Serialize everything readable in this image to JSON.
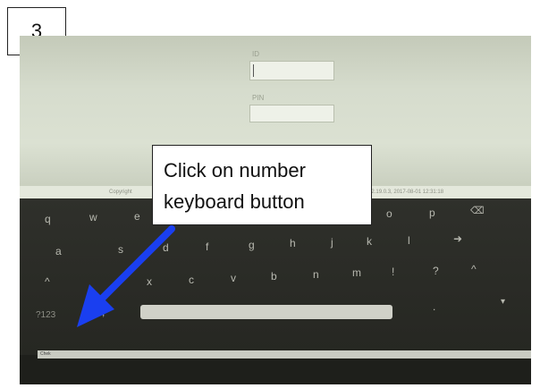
{
  "step": {
    "number": "3"
  },
  "login": {
    "id_label": "ID",
    "pin_label": "PIN"
  },
  "status": {
    "left_text": "Copyright",
    "right_text": "2.27.01, 2.19.0.3, 2017-08-01 12:31:18"
  },
  "keyboard": {
    "row1": [
      "q",
      "w",
      "e",
      "",
      "",
      "",
      "",
      "",
      "o",
      "p"
    ],
    "row2": [
      "a",
      "s",
      "d",
      "f",
      "g",
      "h",
      "j",
      "k",
      "l"
    ],
    "row3": [
      "x",
      "c",
      "v",
      "b",
      "n",
      "m",
      "!",
      "?"
    ],
    "symbols_key": "?123",
    "comma_key": ",",
    "period_key": "."
  },
  "taskbar": {
    "label": "Chek"
  },
  "callout": {
    "line1": "Click on number",
    "line2": "keyboard button"
  },
  "colors": {
    "arrow": "#1a3ff0",
    "keyboard_bg": "#2b2c27",
    "screen_bg": "#d6dccd"
  }
}
